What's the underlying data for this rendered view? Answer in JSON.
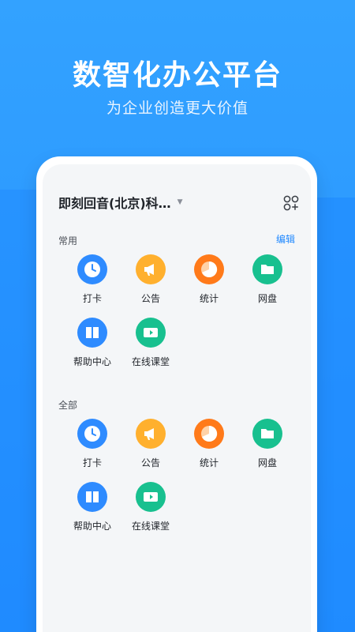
{
  "hero": {
    "title": "数智化办公平台",
    "subtitle": "为企业创造更大价值"
  },
  "org": {
    "name": "即刻回音(北京)科…",
    "caret": "▼"
  },
  "sections": {
    "common": {
      "title": "常用",
      "action": "编辑"
    },
    "all": {
      "title": "全部"
    }
  },
  "apps": [
    {
      "label": "打卡",
      "icon": "clock-icon",
      "color": "#2e8bff"
    },
    {
      "label": "公告",
      "icon": "megaphone-icon",
      "color": "#ffb02e"
    },
    {
      "label": "统计",
      "icon": "pie-chart-icon",
      "color": "#ff7a1a"
    },
    {
      "label": "网盘",
      "icon": "folder-icon",
      "color": "#18c08f"
    },
    {
      "label": "帮助中心",
      "icon": "book-icon",
      "color": "#2e8bff"
    },
    {
      "label": "在线课堂",
      "icon": "video-icon",
      "color": "#18c08f"
    }
  ],
  "colors": {
    "accent": "#1f88ff",
    "background": "#2f9cff"
  }
}
